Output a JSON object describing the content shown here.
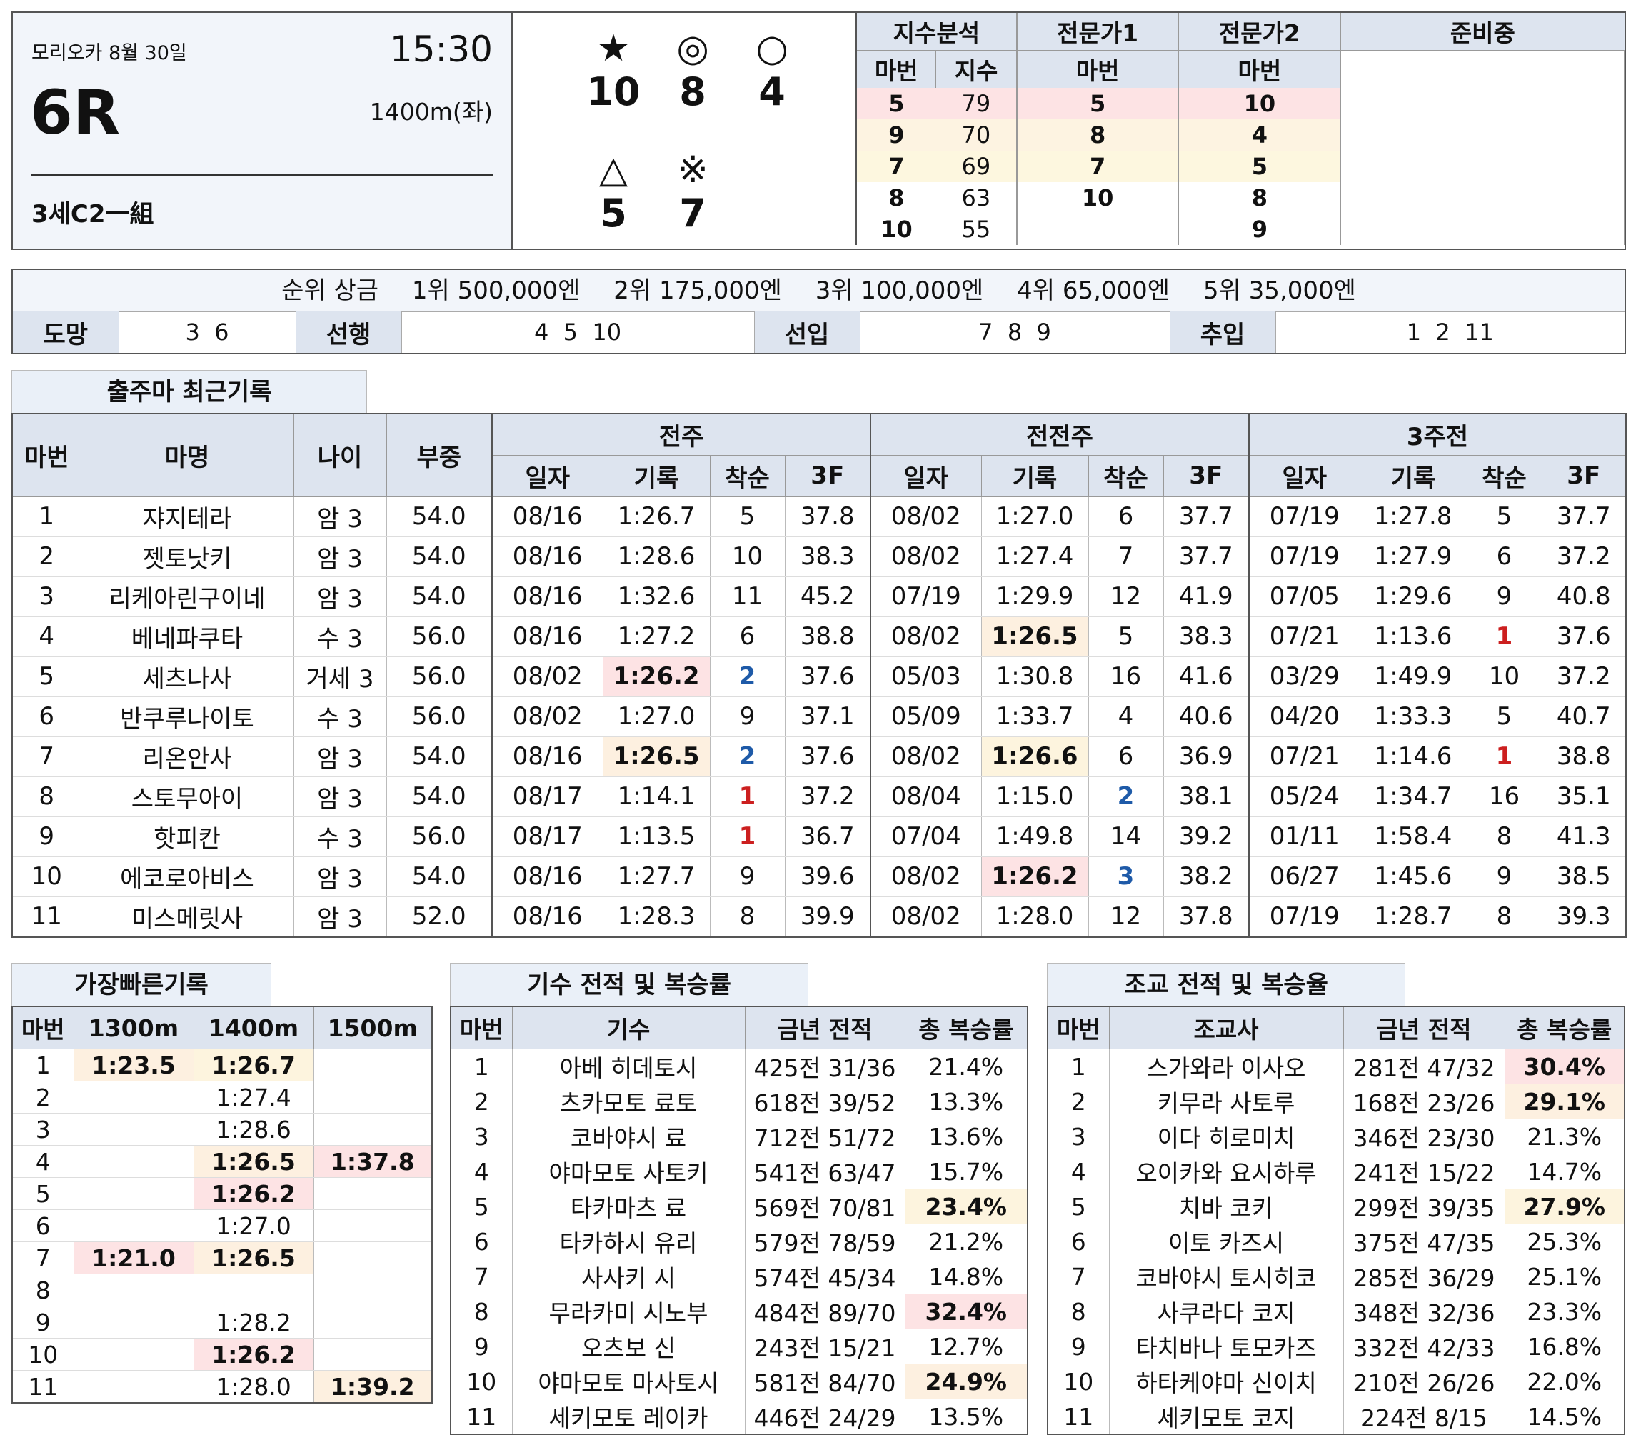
{
  "race": {
    "venue_date": "모리오카 8월 30일",
    "time": "15:30",
    "race_no": "6R",
    "distance": "1400m(좌)",
    "class": "3세C2一組"
  },
  "picks": [
    {
      "symbol": "★",
      "number": "10"
    },
    {
      "symbol": "◎",
      "number": "8"
    },
    {
      "symbol": "○",
      "number": "4"
    },
    {
      "symbol": "△",
      "number": "5"
    },
    {
      "symbol": "※",
      "number": "7"
    }
  ],
  "index_panel": {
    "groups": [
      "지수분석",
      "전문가1",
      "전문가2",
      "준비중"
    ],
    "sub_headers": [
      "마번",
      "지수",
      "마번",
      "마번"
    ],
    "rows": [
      {
        "idx_no": "5",
        "idx_val": "79",
        "exp1": "5",
        "exp2": "10"
      },
      {
        "idx_no": "9",
        "idx_val": "70",
        "exp1": "8",
        "exp2": "4"
      },
      {
        "idx_no": "7",
        "idx_val": "69",
        "exp1": "7",
        "exp2": "5"
      },
      {
        "idx_no": "8",
        "idx_val": "63",
        "exp1": "10",
        "exp2": "8"
      },
      {
        "idx_no": "10",
        "idx_val": "55",
        "exp1": "",
        "exp2": "9"
      }
    ]
  },
  "prize": {
    "label": "순위 상금",
    "items": [
      "1위 500,000엔",
      "2위 175,000엔",
      "3위 100,000엔",
      "4위 65,000엔",
      "5위 35,000엔"
    ]
  },
  "running_style": [
    {
      "label": "도망",
      "value": "3  6"
    },
    {
      "label": "선행",
      "value": "4  5  10"
    },
    {
      "label": "선입",
      "value": "7  8  9"
    },
    {
      "label": "추입",
      "value": "1  2  11"
    }
  ],
  "recent": {
    "tab": "출주마 최근기록",
    "headers": [
      "마번",
      "마명",
      "나이",
      "부중"
    ],
    "groups": [
      "전주",
      "전전주",
      "3주전"
    ],
    "sub_headers": [
      "일자",
      "기록",
      "착순",
      "3F"
    ],
    "rows": [
      {
        "no": "1",
        "name": "쟈지테라",
        "age": "암 3",
        "wt": "54.0",
        "r": [
          [
            "08/16",
            "1:26.7",
            "5",
            "37.8"
          ],
          [
            "08/02",
            "1:27.0",
            "6",
            "37.7"
          ],
          [
            "07/19",
            "1:27.8",
            "5",
            "37.7"
          ]
        ]
      },
      {
        "no": "2",
        "name": "젯토낫키",
        "age": "암 3",
        "wt": "54.0",
        "r": [
          [
            "08/16",
            "1:28.6",
            "10",
            "38.3"
          ],
          [
            "08/02",
            "1:27.4",
            "7",
            "37.7"
          ],
          [
            "07/19",
            "1:27.9",
            "6",
            "37.2"
          ]
        ]
      },
      {
        "no": "3",
        "name": "리케아린구이네",
        "age": "암 3",
        "wt": "54.0",
        "r": [
          [
            "08/16",
            "1:32.6",
            "11",
            "45.2"
          ],
          [
            "07/19",
            "1:29.9",
            "12",
            "41.9"
          ],
          [
            "07/05",
            "1:29.6",
            "9",
            "40.8"
          ]
        ]
      },
      {
        "no": "4",
        "name": "베네파쿠타",
        "age": "수 3",
        "wt": "56.0",
        "r": [
          [
            "08/16",
            "1:27.2",
            "6",
            "38.8"
          ],
          [
            "08/02",
            "1:26.5",
            "5",
            "38.3"
          ],
          [
            "07/21",
            "1:13.6",
            "1",
            "37.6"
          ]
        ]
      },
      {
        "no": "5",
        "name": "세츠나사",
        "age": "거세 3",
        "wt": "56.0",
        "r": [
          [
            "08/02",
            "1:26.2",
            "2",
            "37.6"
          ],
          [
            "05/03",
            "1:30.8",
            "16",
            "41.6"
          ],
          [
            "03/29",
            "1:49.9",
            "10",
            "37.2"
          ]
        ]
      },
      {
        "no": "6",
        "name": "반쿠루나이토",
        "age": "수 3",
        "wt": "56.0",
        "r": [
          [
            "08/02",
            "1:27.0",
            "9",
            "37.1"
          ],
          [
            "05/09",
            "1:33.7",
            "4",
            "40.6"
          ],
          [
            "04/20",
            "1:33.3",
            "5",
            "40.7"
          ]
        ]
      },
      {
        "no": "7",
        "name": "리온안사",
        "age": "암 3",
        "wt": "54.0",
        "r": [
          [
            "08/16",
            "1:26.5",
            "2",
            "37.6"
          ],
          [
            "08/02",
            "1:26.6",
            "6",
            "36.9"
          ],
          [
            "07/21",
            "1:14.6",
            "1",
            "38.8"
          ]
        ]
      },
      {
        "no": "8",
        "name": "스토무아이",
        "age": "암 3",
        "wt": "54.0",
        "r": [
          [
            "08/17",
            "1:14.1",
            "1",
            "37.2"
          ],
          [
            "08/04",
            "1:15.0",
            "2",
            "38.1"
          ],
          [
            "05/24",
            "1:34.7",
            "16",
            "35.1"
          ]
        ]
      },
      {
        "no": "9",
        "name": "핫피칸",
        "age": "수 3",
        "wt": "56.0",
        "r": [
          [
            "08/17",
            "1:13.5",
            "1",
            "36.7"
          ],
          [
            "07/04",
            "1:49.8",
            "14",
            "39.2"
          ],
          [
            "01/11",
            "1:58.4",
            "8",
            "41.3"
          ]
        ]
      },
      {
        "no": "10",
        "name": "에코로아비스",
        "age": "암 3",
        "wt": "54.0",
        "r": [
          [
            "08/16",
            "1:27.7",
            "9",
            "39.6"
          ],
          [
            "08/02",
            "1:26.2",
            "3",
            "38.2"
          ],
          [
            "06/27",
            "1:45.6",
            "9",
            "38.5"
          ]
        ]
      },
      {
        "no": "11",
        "name": "미스메릿사",
        "age": "암 3",
        "wt": "52.0",
        "r": [
          [
            "08/16",
            "1:28.3",
            "8",
            "39.9"
          ],
          [
            "08/02",
            "1:28.0",
            "12",
            "37.8"
          ],
          [
            "07/19",
            "1:28.7",
            "8",
            "39.3"
          ]
        ]
      }
    ],
    "highlights": {
      "pink": [
        "4-0-1",
        "9-1-1"
      ],
      "cream": [
        "6-0-1",
        "3-1-1"
      ],
      "yellow": [
        "6-1-1"
      ]
    }
  },
  "fastest": {
    "tab": "가장빠른기록",
    "headers": [
      "마번",
      "1300m",
      "1400m",
      "1500m"
    ],
    "rows": [
      [
        "1",
        "1:23.5",
        "1:26.7",
        ""
      ],
      [
        "2",
        "",
        "1:27.4",
        ""
      ],
      [
        "3",
        "",
        "1:28.6",
        ""
      ],
      [
        "4",
        "",
        "1:26.5",
        "1:37.8"
      ],
      [
        "5",
        "",
        "1:26.2",
        ""
      ],
      [
        "6",
        "",
        "1:27.0",
        ""
      ],
      [
        "7",
        "1:21.0",
        "1:26.5",
        ""
      ],
      [
        "8",
        "",
        "",
        ""
      ],
      [
        "9",
        "",
        "1:28.2",
        ""
      ],
      [
        "10",
        "",
        "1:26.2",
        ""
      ],
      [
        "11",
        "",
        "1:28.0",
        "1:39.2"
      ]
    ]
  },
  "jockey": {
    "tab": "기수 전적 및 복승률",
    "headers": [
      "마번",
      "기수",
      "금년 전적",
      "총 복승률"
    ],
    "rows": [
      [
        "1",
        "아베 히데토시",
        "425전 31/36",
        "21.4%"
      ],
      [
        "2",
        "츠카모토 료토",
        "618전 39/52",
        "13.3%"
      ],
      [
        "3",
        "코바야시 료",
        "712전 51/72",
        "13.6%"
      ],
      [
        "4",
        "야마모토 사토키",
        "541전 63/47",
        "15.7%"
      ],
      [
        "5",
        "타카마츠 료",
        "569전 70/81",
        "23.4%"
      ],
      [
        "6",
        "타카하시 유리",
        "579전 78/59",
        "21.2%"
      ],
      [
        "7",
        "사사키 시",
        "574전 45/34",
        "14.8%"
      ],
      [
        "8",
        "무라카미 시노부",
        "484전 89/70",
        "32.4%"
      ],
      [
        "9",
        "오츠보 신",
        "243전 15/21",
        "12.7%"
      ],
      [
        "10",
        "야마모토 마사토시",
        "581전 84/70",
        "24.9%"
      ],
      [
        "11",
        "세키모토 레이카",
        "446전 24/29",
        "13.5%"
      ]
    ]
  },
  "trainer": {
    "tab": "조교 전적 및 복승율",
    "headers": [
      "마번",
      "조교사",
      "금년 전적",
      "총 복승률"
    ],
    "rows": [
      [
        "1",
        "스가와라 이사오",
        "281전 47/32",
        "30.4%"
      ],
      [
        "2",
        "키무라 사토루",
        "168전 23/26",
        "29.1%"
      ],
      [
        "3",
        "이다 히로미치",
        "346전 23/30",
        "21.3%"
      ],
      [
        "4",
        "오이카와 요시하루",
        "241전 15/22",
        "14.7%"
      ],
      [
        "5",
        "치바 코키",
        "299전 39/35",
        "27.9%"
      ],
      [
        "6",
        "이토 카즈시",
        "375전 47/35",
        "25.3%"
      ],
      [
        "7",
        "코바야시 토시히코",
        "285전 36/29",
        "25.1%"
      ],
      [
        "8",
        "사쿠라다 코지",
        "348전 32/36",
        "23.3%"
      ],
      [
        "9",
        "타치바나 토모카즈",
        "332전 42/33",
        "16.8%"
      ],
      [
        "10",
        "하타케야마 신이치",
        "210전 26/26",
        "22.0%"
      ],
      [
        "11",
        "세키모토 코지",
        "224전 8/15",
        "14.5%"
      ]
    ]
  },
  "colors": {
    "header_bg": "#dde4ef",
    "panel_bg": "#f2f5fa",
    "pink": "#fde3e4",
    "cream": "#fdf0e0",
    "yellow": "#fdf4de",
    "first_place": "#cc1f1f",
    "placed": "#1e5aa8"
  }
}
